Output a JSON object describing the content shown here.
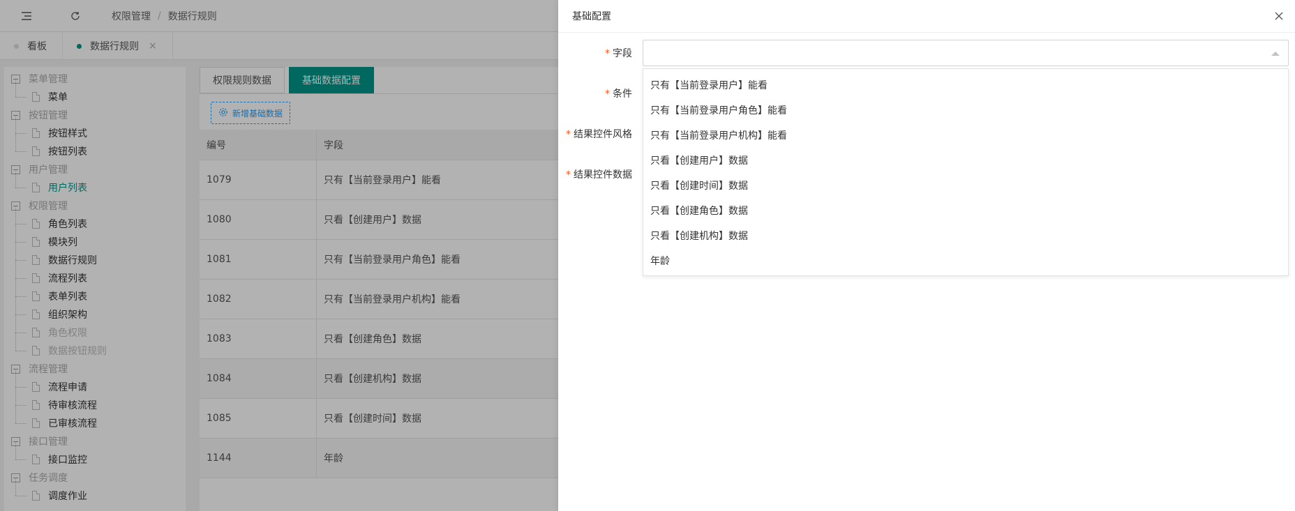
{
  "topbar": {
    "menu_icon": "hamburger-icon",
    "refresh_icon": "refresh-icon",
    "breadcrumb": [
      "权限管理",
      "数据行规则"
    ],
    "breadcrumb_sep": "/"
  },
  "tabs": [
    {
      "label": "看板",
      "active": false
    },
    {
      "label": "数据行规则",
      "active": true,
      "close": "×"
    }
  ],
  "tree": [
    {
      "group": "菜单管理",
      "items": [
        {
          "label": "菜单"
        }
      ]
    },
    {
      "group": "按钮管理",
      "items": [
        {
          "label": "按钮样式"
        },
        {
          "label": "按钮列表"
        }
      ]
    },
    {
      "group": "用户管理",
      "items": [
        {
          "label": "用户列表",
          "selected": true
        }
      ]
    },
    {
      "group": "权限管理",
      "items": [
        {
          "label": "角色列表"
        },
        {
          "label": "模块列"
        },
        {
          "label": "数据行规则"
        },
        {
          "label": "流程列表"
        },
        {
          "label": "表单列表"
        },
        {
          "label": "组织架构"
        },
        {
          "label": "角色权限",
          "disabled": true
        },
        {
          "label": "数据按钮规则",
          "disabled": true
        }
      ]
    },
    {
      "group": "流程管理",
      "items": [
        {
          "label": "流程申请"
        },
        {
          "label": "待审核流程"
        },
        {
          "label": "已审核流程"
        }
      ]
    },
    {
      "group": "接口管理",
      "items": [
        {
          "label": "接口监控"
        }
      ]
    },
    {
      "group": "任务调度",
      "items": [
        {
          "label": "调度作业"
        }
      ]
    }
  ],
  "content": {
    "tabs": [
      {
        "label": "权限规则数据",
        "active": false
      },
      {
        "label": "基础数据配置",
        "active": true
      }
    ],
    "add_button": "新增基础数据",
    "table": {
      "columns": [
        "编号",
        "字段"
      ],
      "rows": [
        [
          "1079",
          "只有【当前登录用户】能看"
        ],
        [
          "1080",
          "只看【创建用户】数据"
        ],
        [
          "1081",
          "只有【当前登录用户角色】能看"
        ],
        [
          "1082",
          "只有【当前登录用户机构】能看"
        ],
        [
          "1083",
          "只看【创建角色】数据"
        ],
        [
          "1084",
          "只看【创建机构】数据"
        ],
        [
          "1085",
          "只看【创建时间】数据"
        ],
        [
          "1144",
          "年龄"
        ]
      ]
    }
  },
  "drawer": {
    "title": "基础配置",
    "close_icon": "close-icon",
    "fields": [
      {
        "label": "字段",
        "required": true
      },
      {
        "label": "条件",
        "required": true
      },
      {
        "label": "结果控件风格",
        "required": true
      },
      {
        "label": "结果控件数据",
        "required": true
      }
    ],
    "required_mark": "*",
    "field_select": {
      "value": "",
      "open": true
    },
    "options": [
      "只有【当前登录用户】能看",
      "只有【当前登录用户角色】能看",
      "只有【当前登录用户机构】能看",
      "只看【创建用户】数据",
      "只看【创建时间】数据",
      "只看【创建角色】数据",
      "只看【创建机构】数据",
      "年龄"
    ]
  },
  "colors": {
    "accent": "#009688",
    "link": "#1e9fff",
    "required": "#ff5722"
  }
}
